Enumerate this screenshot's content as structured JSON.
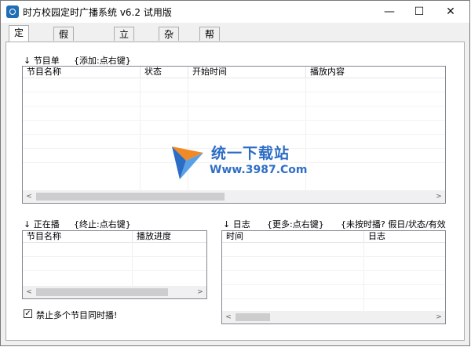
{
  "window": {
    "title": "时方校园定时广播系统 v6.2 试用版",
    "minimize_glyph": "—",
    "maximize_glyph": "☐",
    "close_glyph": "✕"
  },
  "tabs": [
    "定时播",
    "假日或雨天",
    "立即播",
    "杂项",
    "帮助"
  ],
  "program_list": {
    "label": "↓ 节目单",
    "hint": "{添加:点右键}",
    "columns": [
      "节目名称",
      "状态",
      "开始时间",
      "播放内容"
    ]
  },
  "now_playing": {
    "label": "↓ 正在播",
    "hint": "{终止:点右键}",
    "columns": [
      "节目名称",
      "播放进度"
    ]
  },
  "log": {
    "label": "↓ 日志",
    "hint": "{更多:点右键}",
    "hint2": "{未按时播? 假日/状态/有效",
    "columns": [
      "时间",
      "日志"
    ]
  },
  "checkbox": {
    "label": "禁止多个节目同时播!",
    "checked": true
  },
  "watermark": {
    "text": "统一下载站",
    "url": "Www.3987.Com"
  },
  "scroll": {
    "left_arrow": "<",
    "right_arrow": ">"
  }
}
